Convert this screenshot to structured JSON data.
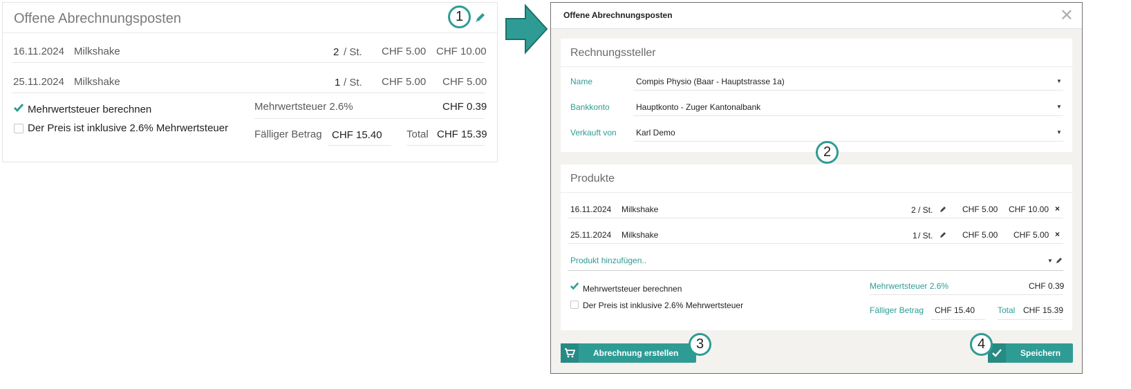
{
  "left": {
    "title": "Offene Abrechnungsposten",
    "callout": "1",
    "edit_icon": "pencil-icon",
    "items": [
      {
        "date": "16.11.2024",
        "name": "Milkshake",
        "qty": "2",
        "unit": "/ St.",
        "price": "CHF 5.00",
        "total": "CHF 10.00"
      },
      {
        "date": "25.11.2024",
        "name": "Milkshake",
        "qty": "1",
        "unit": "/ St.",
        "price": "CHF 5.00",
        "total": "CHF 5.00"
      }
    ],
    "vat_checkbox": "Mehrwertsteuer berechnen",
    "incl_checkbox": "Der Preis ist inklusive 2.6% Mehrwertsteuer",
    "vat_label": "Mehrwertsteuer 2.6%",
    "vat_value": "CHF 0.39",
    "due_label": "Fälliger Betrag",
    "due_value": "CHF 15.40",
    "total_label": "Total",
    "total_value": "CHF 15.39"
  },
  "modal": {
    "title": "Offene Abrechnungsposten",
    "close": "✕",
    "section1_title": "Rechnungssteller",
    "fields": [
      {
        "label": "Name",
        "value": "Compis Physio (Baar - Hauptstrasse 1a)"
      },
      {
        "label": "Bankkonto",
        "value": "Hauptkonto - Zuger Kantonalbank"
      },
      {
        "label": "Verkauft von",
        "value": "Karl Demo"
      }
    ],
    "callout2": "2",
    "section2_title": "Produkte",
    "items": [
      {
        "date": "16.11.2024",
        "name": "Milkshake",
        "qty": "2",
        "unit": "/ St.",
        "price": "CHF 5.00",
        "total": "CHF 10.00",
        "remove": "×"
      },
      {
        "date": "25.11.2024",
        "name": "Milkshake",
        "qty": "1",
        "unit": "/ St.",
        "price": "CHF 5.00",
        "total": "CHF 5.00",
        "remove": "×"
      }
    ],
    "add_product": "Produkt hinzufügen..",
    "vat_checkbox": "Mehrwertsteuer berechnen",
    "incl_checkbox": "Der Preis ist inklusive 2.6% Mehrwertsteuer",
    "vat_label": "Mehrwertsteuer 2.6%",
    "vat_value": "CHF 0.39",
    "due_label": "Fälliger Betrag",
    "due_value": "CHF 15.40",
    "total_label": "Total",
    "total_value": "CHF 15.39",
    "create_button": "Abrechnung erstellen",
    "create_icon": "cart-icon",
    "callout3": "3",
    "save_button": "Speichern",
    "save_icon": "check-icon",
    "callout4": "4"
  },
  "colors": {
    "accent": "#2e9c94",
    "arrow": "#2e9c94"
  }
}
